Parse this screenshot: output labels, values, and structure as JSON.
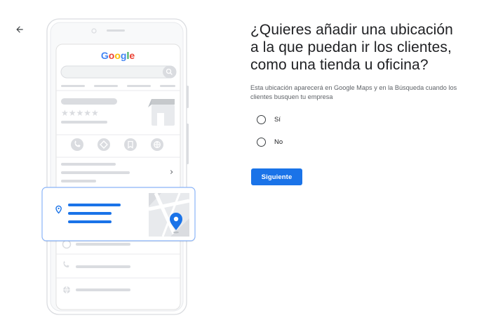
{
  "header": {
    "back_icon": "arrow-back-icon"
  },
  "illustration": {
    "brand": {
      "letters": [
        {
          "char": "G",
          "color": "#4285F4"
        },
        {
          "char": "o",
          "color": "#EA4335"
        },
        {
          "char": "o",
          "color": "#FBBC05"
        },
        {
          "char": "g",
          "color": "#4285F4"
        },
        {
          "char": "l",
          "color": "#34A853"
        },
        {
          "char": "e",
          "color": "#EA4335"
        }
      ]
    },
    "rating_stars": "★★★★★",
    "chevron": "›",
    "icons": [
      "phone-icon",
      "directions-icon",
      "bookmark-icon",
      "website-icon",
      "pin-icon",
      "map-pin-icon",
      "clock-icon"
    ]
  },
  "question": {
    "title": "¿Quieres añadir una ubicación a la que puedan ir los clientes, como una tienda u oficina?",
    "description": "Esta ubicación aparecerá en Google Maps y en la Búsqueda cuando los clientes busquen tu empresa"
  },
  "options": [
    {
      "label": "Sí",
      "selected": false
    },
    {
      "label": "No",
      "selected": false
    }
  ],
  "actions": {
    "next_label": "Siguiente"
  },
  "colors": {
    "accent": "#1a73e8",
    "map_pin": "#1a73e8",
    "text_primary": "#202124",
    "text_secondary": "#5f6368",
    "placeholder_gray": "#dadce0"
  }
}
